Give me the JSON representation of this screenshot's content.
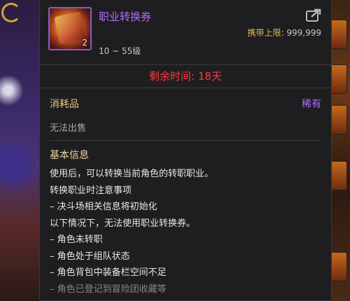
{
  "item": {
    "name": "职业转换券",
    "count": "2",
    "carry_limit_label": "携带上限:",
    "carry_limit_value": "999,999",
    "level_range": "10 ~ 55级",
    "icon": "class-change-ticket-icon"
  },
  "timer": {
    "label": "剩余时间:",
    "value": "18天"
  },
  "category": "消耗品",
  "rarity": "稀有",
  "tradeable": "无法出售",
  "info_title": "基本信息",
  "description": [
    "使用后，可以转换当前角色的转职职业。",
    "转换职业时注意事项",
    "– 决斗场相关信息将初始化",
    "以下情况下，无法使用职业转换券。",
    "– 角色未转职",
    "– 角色处于组队状态",
    "– 角色背包中装备栏空间不足",
    "– 角色已登记到冒险团收藏等"
  ],
  "colors": {
    "item_name": "#b46cff",
    "rarity": "#b46cff",
    "timer": "#ff3b3b",
    "category": "#f0c870",
    "carry_label": "#e0b860"
  }
}
